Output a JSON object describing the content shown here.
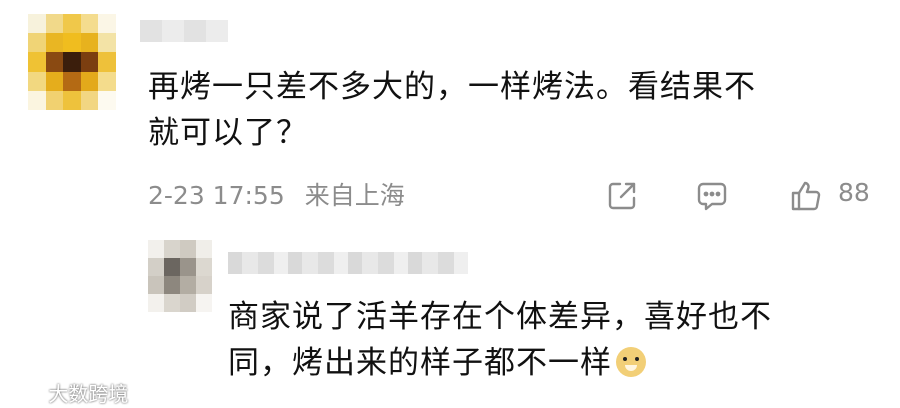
{
  "main_comment": {
    "text_line1": "再烤一只差不多大的，一样烤法。看结果不",
    "text_line2": "就可以了？",
    "date": "2-23 17:55",
    "location": "来自上海",
    "like_count": "88",
    "icons": [
      "share-icon",
      "comment-icon",
      "like-icon"
    ]
  },
  "reply": {
    "text_line1": "商家说了活羊存在个体差异，喜好也不",
    "text_line2": "同，烤出来的样子都不一样"
  },
  "watermark": "大数跨境",
  "colors": {
    "meta_gray": "#8c8c8c",
    "text": "#111111",
    "avatar_yellow": "#f2c230"
  }
}
